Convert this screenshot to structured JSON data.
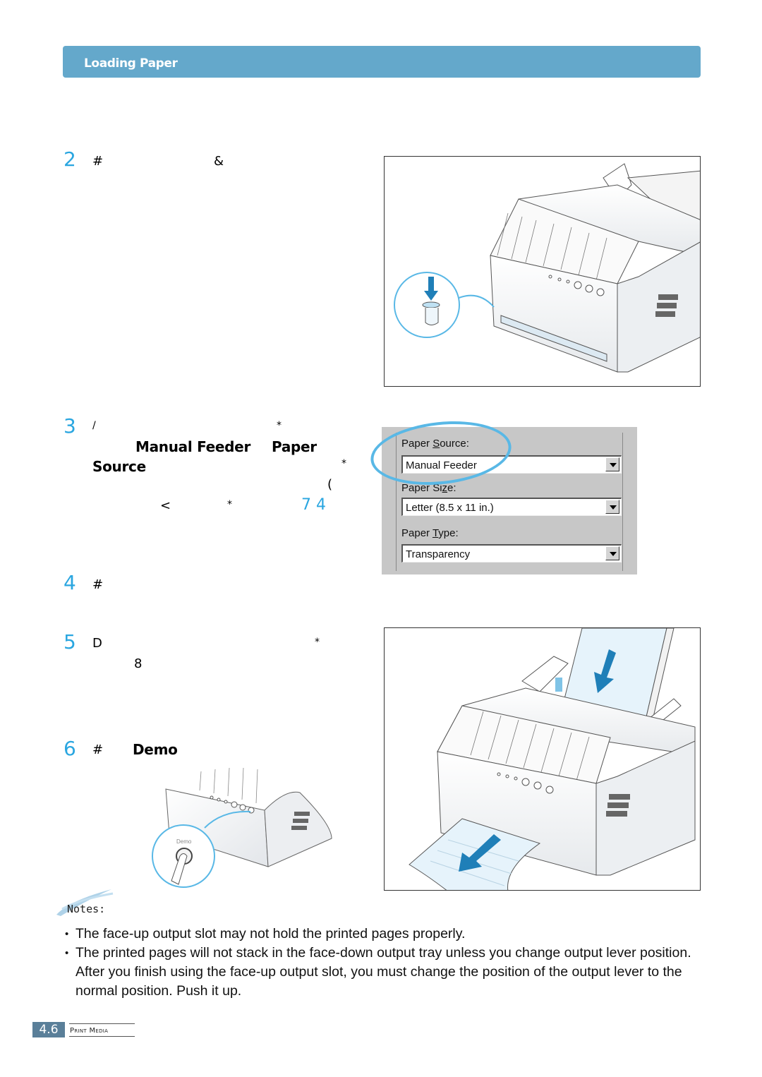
{
  "header": {
    "title": "Loading Paper"
  },
  "steps": [
    {
      "number": "2",
      "glyphs": [
        "#",
        "&"
      ]
    },
    {
      "number": "3",
      "glyphs": [
        "/",
        "*",
        "*",
        "(",
        "<",
        "*"
      ],
      "bold": [
        "Manual Feeder",
        "Paper",
        "Source"
      ],
      "link_ref": "7 4"
    },
    {
      "number": "4",
      "glyphs": [
        "#"
      ]
    },
    {
      "number": "5",
      "glyphs": [
        "D",
        "*",
        "8"
      ]
    },
    {
      "number": "6",
      "glyphs": [
        "#"
      ],
      "bold": [
        "Demo"
      ]
    }
  ],
  "dialog": {
    "paper_source": {
      "label_pre": "Paper ",
      "label_accel": "S",
      "label_post": "ource:",
      "value": "Manual Feeder"
    },
    "paper_size": {
      "label_pre": "Paper Si",
      "label_accel": "z",
      "label_post": "e:",
      "value": "Letter (8.5 x 11 in.)"
    },
    "paper_type": {
      "label_pre": "Paper ",
      "label_accel": "T",
      "label_post": "ype:",
      "value": "Transparency"
    },
    "highlight_color": "#59b8e6"
  },
  "figures": {
    "manual_feed_lever": "printer-manual-feed-lever-illustration",
    "demo_button": "printer-demo-button-illustration",
    "demo_button_label": "Demo",
    "paper_feed": "printer-paper-feed-illustration"
  },
  "notes": {
    "label": "Notes:",
    "items": [
      "The face-up output slot may not hold the printed pages properly.",
      "The printed pages will not stack in the face-down output tray unless you change output lever position. After you finish using the face-up output slot, you must change the position of the output lever to the normal position. Push it up."
    ]
  },
  "footer": {
    "page_number": "4.6",
    "section": "Print Media"
  },
  "colors": {
    "header_band": "#64a8cb",
    "step_number": "#2aa6e0",
    "page_badge": "#5a7f99"
  }
}
